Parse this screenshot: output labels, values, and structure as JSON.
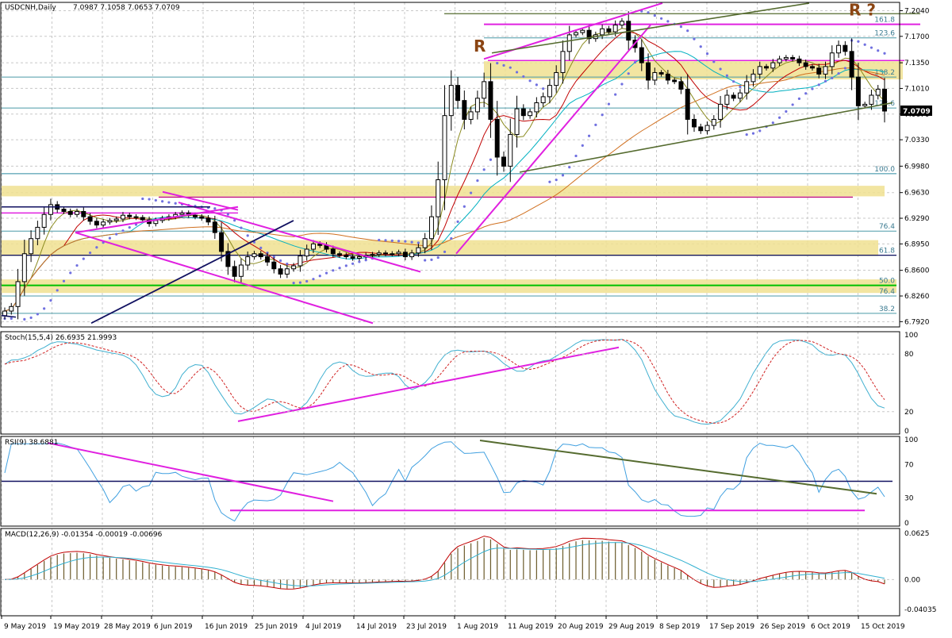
{
  "chart_data": [
    {
      "type": "candlestick",
      "panel": "price",
      "symbol_label": "USDCNH,Daily",
      "ohlc_label": "7.0987 7.1058 7.0653 7.0709",
      "current_price_label": "7.0709",
      "ylim": [
        6.785,
        7.215
      ],
      "y_ticks": [
        "7.2040",
        "7.1700",
        "7.1350",
        "7.1010",
        "7.0670",
        "7.0330",
        "6.9980",
        "6.9630",
        "6.9290",
        "6.8950",
        "6.8600",
        "6.8260",
        "6.7920"
      ],
      "y_tick_values": [
        7.204,
        7.17,
        7.135,
        7.101,
        7.067,
        7.033,
        6.998,
        6.963,
        6.929,
        6.895,
        6.86,
        6.826,
        6.792
      ],
      "fib_levels": [
        {
          "label": "161.8",
          "value": 7.186
        },
        {
          "label": "123.6",
          "value": 7.168
        },
        {
          "label": "138.2",
          "value": 7.116
        },
        {
          "label": "123.6",
          "value": 7.075
        },
        {
          "label": "100.0",
          "value": 6.988
        },
        {
          "label": "76.4",
          "value": 6.912
        },
        {
          "label": "61.8",
          "value": 6.88
        },
        {
          "label": "50.0",
          "value": 6.84
        },
        {
          "label": "76.4",
          "value": 6.826
        },
        {
          "label": "38.2",
          "value": 6.803
        }
      ],
      "annotations": [
        {
          "text": "R"
        },
        {
          "text": "R ?"
        }
      ],
      "x_labels": [
        "9 May 2019",
        "19 May 2019",
        "28 May 2019",
        "6 Jun 2019",
        "16 Jun 2019",
        "25 Jun 2019",
        "4 Jul 2019",
        "14 Jul 2019",
        "23 Jul 2019",
        "1 Aug 2019",
        "11 Aug 2019",
        "20 Aug 2019",
        "29 Aug 2019",
        "8 Sep 2019",
        "17 Sep 2019",
        "26 Sep 2019",
        "6 Oct 2019",
        "15 Oct 2019"
      ],
      "close": [
        6.806,
        6.812,
        6.845,
        6.882,
        6.902,
        6.917,
        6.934,
        6.947,
        6.941,
        6.938,
        6.934,
        6.938,
        6.931,
        6.925,
        6.92,
        6.924,
        6.926,
        6.928,
        6.933,
        6.931,
        6.93,
        6.927,
        6.922,
        6.926,
        6.929,
        6.931,
        6.934,
        6.936,
        6.933,
        6.931,
        6.929,
        6.924,
        6.91,
        6.885,
        6.865,
        6.852,
        6.867,
        6.878,
        6.882,
        6.878,
        6.871,
        6.862,
        6.855,
        6.862,
        6.866,
        6.879,
        6.888,
        6.895,
        6.893,
        6.888,
        6.882,
        6.88,
        6.878,
        6.876,
        6.878,
        6.88,
        6.881,
        6.883,
        6.882,
        6.882,
        6.884,
        6.878,
        6.883,
        6.89,
        6.902,
        6.931,
        6.98,
        7.065,
        7.105,
        7.085,
        7.06,
        7.07,
        7.088,
        7.11,
        7.06,
        7.01,
        6.998,
        7.04,
        7.074,
        7.065,
        7.07,
        7.082,
        7.09,
        7.105,
        7.122,
        7.15,
        7.172,
        7.175,
        7.178,
        7.167,
        7.172,
        7.18,
        7.176,
        7.185,
        7.19,
        7.165,
        7.155,
        7.135,
        7.112,
        7.122,
        7.12,
        7.112,
        7.11,
        7.1,
        7.06,
        7.05,
        7.045,
        7.052,
        7.06,
        7.08,
        7.092,
        7.088,
        7.095,
        7.11,
        7.12,
        7.13,
        7.128,
        7.135,
        7.14,
        7.142,
        7.14,
        7.135,
        7.13,
        7.128,
        7.12,
        7.13,
        7.148,
        7.158,
        7.15,
        7.116,
        7.078,
        7.08,
        7.092,
        7.1,
        7.071
      ],
      "ma_fast_color": "#c00000",
      "ma_mid_color": "#00b0c0",
      "ma_slow_color": "#d07020"
    },
    {
      "type": "line",
      "panel": "stochastic",
      "label": "Stoch(15,5,4) 26.6935 21.9993",
      "y_ticks": [
        "100",
        "80",
        "20",
        "0"
      ],
      "y_tick_values": [
        100,
        80,
        20,
        0
      ]
    },
    {
      "type": "line",
      "panel": "rsi",
      "label": "RSI(9) 38.6881",
      "y_ticks": [
        "100",
        "70",
        "30",
        "0"
      ],
      "y_tick_values": [
        100,
        70,
        30,
        0
      ]
    },
    {
      "type": "bar",
      "panel": "macd",
      "label": "MACD(12,26,9) -0.01354 -0.00019 -0.00696",
      "y_ticks": [
        "0.0625",
        "0.00",
        "-0.04035"
      ],
      "y_tick_values": [
        0.0625,
        0.0,
        -0.04035
      ]
    }
  ],
  "colors": {
    "background": "#ffffff",
    "grid": "#c8c8c8",
    "bull": "#ffffff",
    "bear": "#000000",
    "zone": "#f0e090",
    "magenta": "#e020e0",
    "olive": "#556b2f",
    "navy": "#101060",
    "green": "#00c000",
    "psar": "#7070e0",
    "stoch_main": "#40b0d0",
    "stoch_signal": "#d02020",
    "rsi": "#40a0e0",
    "macd_hist": "#6b5a2a",
    "macd_line": "#c00000",
    "signal_line": "#30b0d0"
  }
}
